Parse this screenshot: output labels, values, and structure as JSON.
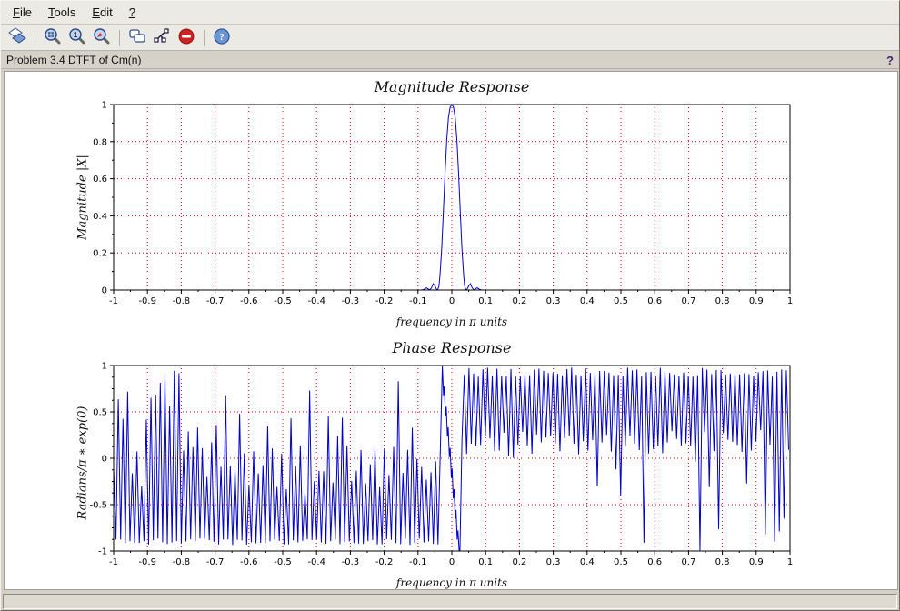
{
  "colors": {
    "curve": "#0000cc",
    "grid": "#dd0000",
    "axis": "#000000",
    "help": "#44276b",
    "stop_red": "#cc2222",
    "icon_blue": "#2a4a8a"
  },
  "menu": {
    "items": [
      {
        "label": "File",
        "underline": 0
      },
      {
        "label": "Tools",
        "underline": 0
      },
      {
        "label": "Edit",
        "underline": 0
      },
      {
        "label": "?",
        "underline": 0
      }
    ]
  },
  "toolbar": {
    "icons": [
      "rotate",
      "zoom-area",
      "original-view",
      "zoom-out",
      "copy",
      "graphics-editor",
      "stop",
      "about"
    ]
  },
  "infobar": {
    "title": "Problem 3.4 DTFT of Cm(n)",
    "help": "?"
  },
  "statusbar": {
    "text": ""
  },
  "chart_data": [
    {
      "type": "line",
      "title": "Magnitude Response",
      "xlabel": "frequency in π units",
      "ylabel": "Magnitude |X|",
      "xlim": [
        -1,
        1
      ],
      "ylim": [
        0,
        1
      ],
      "grid": true,
      "legend_position": "none",
      "xticks": {
        "values": [
          -1,
          -0.9,
          -0.8,
          -0.7,
          -0.6,
          -0.5,
          -0.4,
          -0.3,
          -0.2,
          -0.1,
          0,
          0.1,
          0.2,
          0.3,
          0.4,
          0.5,
          0.6,
          0.7,
          0.8,
          0.9,
          1
        ],
        "labels": [
          "-1",
          "-0.9",
          "-0.8",
          "-0.7",
          "-0.6",
          "-0.5",
          "-0.4",
          "-0.3",
          "-0.2",
          "-0.1",
          "0",
          "0.1",
          "0.2",
          "0.3",
          "0.4",
          "0.5",
          "0.6",
          "0.7",
          "0.8",
          "0.9",
          "1"
        ],
        "minor_step": 0.05
      },
      "yticks": {
        "values": [
          0,
          0.2,
          0.4,
          0.6,
          0.8,
          1
        ],
        "labels": [
          "0",
          "0.2",
          "0.4",
          "0.6",
          "0.8",
          "1"
        ],
        "minor_step": 0.1
      },
      "points": [
        [
          -1,
          0
        ],
        [
          -0.09,
          0
        ],
        [
          -0.085,
          0.002
        ],
        [
          -0.08,
          0.006
        ],
        [
          -0.075,
          0.012
        ],
        [
          -0.07,
          0.006
        ],
        [
          -0.065,
          0.001
        ],
        [
          -0.06,
          0.012
        ],
        [
          -0.055,
          0.034
        ],
        [
          -0.05,
          0.022
        ],
        [
          -0.045,
          0.004
        ],
        [
          -0.042,
          0
        ],
        [
          -0.038,
          0.02
        ],
        [
          -0.035,
          0.08
        ],
        [
          -0.03,
          0.22
        ],
        [
          -0.025,
          0.42
        ],
        [
          -0.02,
          0.63
        ],
        [
          -0.015,
          0.81
        ],
        [
          -0.01,
          0.93
        ],
        [
          -0.005,
          0.985
        ],
        [
          0,
          1
        ],
        [
          0.005,
          0.985
        ],
        [
          0.01,
          0.93
        ],
        [
          0.015,
          0.81
        ],
        [
          0.02,
          0.63
        ],
        [
          0.025,
          0.42
        ],
        [
          0.03,
          0.22
        ],
        [
          0.035,
          0.08
        ],
        [
          0.038,
          0.02
        ],
        [
          0.042,
          0
        ],
        [
          0.045,
          0.004
        ],
        [
          0.05,
          0.022
        ],
        [
          0.055,
          0.034
        ],
        [
          0.06,
          0.012
        ],
        [
          0.065,
          0.001
        ],
        [
          0.07,
          0.006
        ],
        [
          0.075,
          0.012
        ],
        [
          0.08,
          0.006
        ],
        [
          0.085,
          0.002
        ],
        [
          0.09,
          0
        ],
        [
          1,
          0
        ]
      ]
    },
    {
      "type": "line",
      "title": "Phase Response",
      "xlabel": "frequency in π units",
      "ylabel": "Radians/π ∗ exp(0)",
      "xlim": [
        -1,
        1
      ],
      "ylim": [
        -1,
        1
      ],
      "grid": true,
      "legend_position": "none",
      "xticks": {
        "values": [
          -1,
          -0.9,
          -0.8,
          -0.7,
          -0.6,
          -0.5,
          -0.4,
          -0.3,
          -0.2,
          -0.1,
          0,
          0.1,
          0.2,
          0.3,
          0.4,
          0.5,
          0.6,
          0.7,
          0.8,
          0.9,
          1
        ],
        "labels": [
          "-1",
          "-0.9",
          "-0.8",
          "-0.7",
          "-0.6",
          "-0.5",
          "-0.4",
          "-0.3",
          "-0.2",
          "-0.1",
          "0",
          "0.1",
          "0.2",
          "0.3",
          "0.4",
          "0.5",
          "0.6",
          "0.7",
          "0.8",
          "0.9",
          "1"
        ],
        "minor_step": 0.05
      },
      "yticks": {
        "values": [
          -1,
          -0.5,
          0,
          0.5,
          1
        ],
        "labels": [
          "-1",
          "-0.5",
          "0",
          "0.5",
          "1"
        ],
        "minor_step": 0.125
      },
      "generator": {
        "seed": 11,
        "half_period": 0.0069,
        "segments": [
          {
            "type": "zigzag",
            "x0": -1,
            "x1": -0.028,
            "fixedSide": "bottom",
            "fixed": -0.9,
            "fixedJitter": 0.035,
            "varBase": -0.12,
            "varJitter": 0.26,
            "spikes": [
              {
                "p": 0.26,
                "lo": 0.05,
                "hi": 0.48
              },
              {
                "p": 0.07,
                "lo": 0.45,
                "hi": 0.98
              }
            ],
            "boost": {
              "zone": [
                -1,
                -0.8
              ],
              "p": 0.5,
              "lo": 0.3,
              "hi": 1.0
            }
          },
          {
            "type": "stair",
            "x0": -0.028,
            "x1": 0.024,
            "yStart": 1.0,
            "yEnd": -1.0,
            "steps": 9,
            "downFactor": 1.45
          },
          {
            "type": "zigzag",
            "x0": 0.03,
            "x1": 1.0,
            "fixedSide": "top",
            "fixed": 0.93,
            "fixedJitter": 0.05,
            "varBase": 0.18,
            "varJitter": 0.14,
            "spikes": [
              {
                "p": 0.1,
                "lo": 0.0,
                "hi": 0.12
              },
              {
                "p": 0.18,
                "lo": -0.45,
                "hi": 0.05,
                "zone": [
                  0.42,
                  1
                ]
              },
              {
                "p": 0.06,
                "lo": -1.0,
                "hi": -0.4,
                "zone": [
                  0.55,
                  1
                ]
              }
            ],
            "boost": {
              "zone": [
                0.9,
                1
              ],
              "p": 0.3,
              "lo": -1.0,
              "hi": -0.35
            }
          }
        ]
      }
    }
  ]
}
